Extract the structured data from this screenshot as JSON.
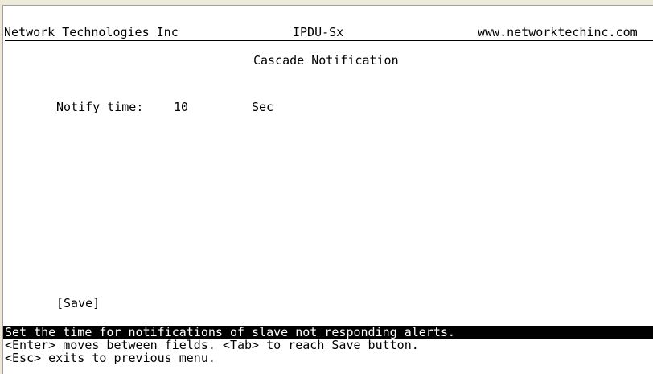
{
  "header": {
    "company": "Network Technologies Inc",
    "product": "IPDU-Sx",
    "website": "www.networktechinc.com"
  },
  "screen": {
    "title": "Cascade Notification"
  },
  "form": {
    "notify_time_label": "Notify time:",
    "notify_time_value": "10",
    "notify_time_unit": "Sec",
    "save_label": "[Save]"
  },
  "help": {
    "status_line": "Set the time for notifications of slave not responding alerts.",
    "line2": "<Enter> moves between fields. <Tab> to reach Save button.",
    "line3": "<Esc> exits to previous menu."
  }
}
